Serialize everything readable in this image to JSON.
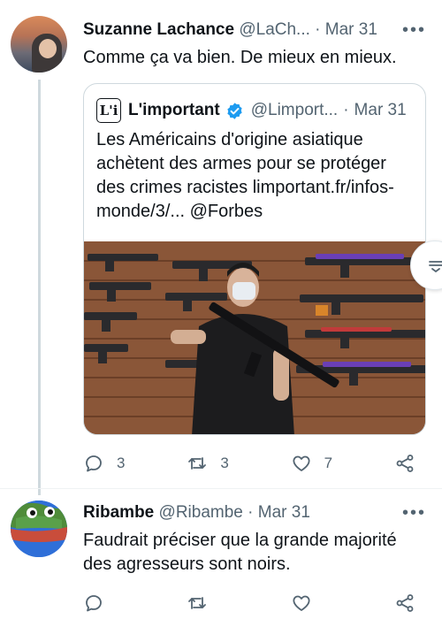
{
  "tweet1": {
    "display_name": "Suzanne Lachance",
    "handle": "@LaCh...",
    "separator": "·",
    "date": "Mar 31",
    "text": "Comme ça va bien. De mieux en mieux.",
    "actions": {
      "replies": "3",
      "retweets": "3",
      "likes": "7"
    },
    "quote": {
      "logo_text": "L'i",
      "display_name": "L'important",
      "handle": "@Limport...",
      "separator": "·",
      "date": "Mar 31",
      "text": "Les Américains d'origine asiatique achètent des armes pour se protéger des crimes racistes limportant.fr/infos-monde/3/... @Forbes"
    }
  },
  "tweet2": {
    "display_name": "Ribambe",
    "handle": "@Ribambe",
    "separator": "·",
    "date": "Mar 31",
    "text": "Faudrait préciser que la grande majorité des agresseurs sont noirs."
  },
  "icons": {
    "reply": "reply-icon",
    "retweet": "retweet-icon",
    "like": "heart-icon",
    "share": "share-icon",
    "more": "more-icon",
    "verified": "verified-badge-icon"
  },
  "colors": {
    "text_primary": "#0f1419",
    "text_secondary": "#536471",
    "verified_blue": "#1d9bf0",
    "border": "#cfd9de"
  }
}
